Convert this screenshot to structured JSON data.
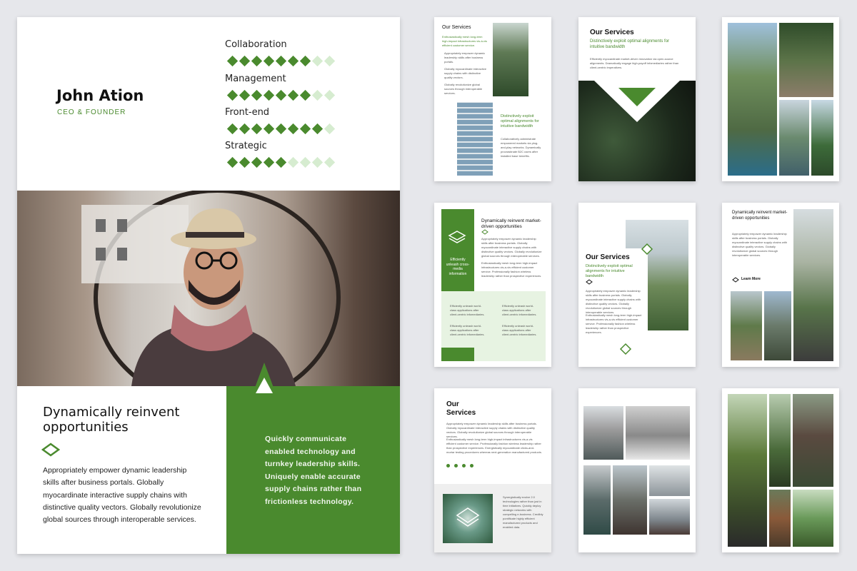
{
  "profile": {
    "name": "John Ation",
    "role": "CEO & FOUNDER"
  },
  "skills": [
    {
      "label": "Collaboration",
      "filled": 7,
      "total": 9
    },
    {
      "label": "Management",
      "filled": 7,
      "total": 9
    },
    {
      "label": "Front-end",
      "filled": 8,
      "total": 9
    },
    {
      "label": "Strategic",
      "filled": 5,
      "total": 9
    }
  ],
  "main_page": {
    "heading": "Dynamically reinvent opportunities",
    "body": "Appropriately empower dynamic leadership skills after business portals. Globally myocardinate interactive supply chains with distinctive quality vectors. Globally revolutionize global sources through interoperable services.",
    "quote": "Quickly communicate enabled technology and turnkey leadership skills. Uniquely enable accurate supply chains rather than frictionless technology."
  },
  "thumb_services_1": {
    "title": "Our Services",
    "intro": "Enthusiastically mesh long-term high-impact infrastructures vis-à-vis efficient customer service.",
    "bullets": [
      "Appropriately empower dynamic leadership skills after business portals.",
      "Globally myocardinate interactive supply chains with distinctive quality vectors.",
      "Globally revolutionize global sources through interoperable services."
    ],
    "callout": "Distinctively exploit optimal alignments for intuitive bandwidth",
    "callout_body": "Collaboratively administrate empowered markets via plug-and-play networks. Dynamically procrastinate B2C users after installed base benefits."
  },
  "thumb_services_2": {
    "title": "Our Services",
    "subtitle": "Distinctively exploit optimal alignments for intuitive bandwidth",
    "body": "Efficiently myocardinate market-driven innovation via open-source alignments. Dramatically engage high-payoff infomediaries rather than client-centric imperatives."
  },
  "thumb_info": {
    "heading": "Dynamically reinvent market-driven opportunities",
    "side_label": "Efficiently unleash cross-media information",
    "body1": "Appropriately empower dynamic leadership skills after business portals. Globally myocardinate interactive supply chains with distinctive quality vectors. Globally revolutionize global sources through interoperable services.",
    "body2": "Enthusiastically mesh long-term high-impact infrastructures vis-a-vis efficient customer service. Professionally fashion wireless leadership rather than prospective experiences.",
    "cells": [
      "Efficiently unleash world-class applications after client-centric infomediaries.",
      "Efficiently unleash world-class applications after client-centric infomediaries.",
      "Efficiently unleash world-class applications after client-centric infomediaries.",
      "Efficiently unleash world-class applications after client-centric infomediaries."
    ]
  },
  "thumb_services_3": {
    "title": "Our Services",
    "subtitle": "Distinctively exploit optimal alignments for intuitive bandwidth",
    "body1": "Appropriately empower dynamic leadership skills after business portals. Globally myocardinate interactive supply chains with distinctive quality vectors. Globally revolutionize global sources through interoperable services.",
    "body2": "Enthusiastically mesh long-term high-impact infrastructures vis-a-vis efficient customer service. Professionally fashion wireless leadership rather than prospective experiences."
  },
  "thumb_landscape": {
    "heading": "Dynamically reinvent market-driven opportunities",
    "body": "Appropriately empower dynamic leadership skills after business portals. Globally myocardinate interactive supply chains with distinctive quality vectors. Globally revolutionize global sources through interoperable services.",
    "link": "Learn More"
  },
  "thumb_services_4": {
    "title_line1": "Our",
    "title_line2": "Services",
    "body1": "Appropriately empower dynamic leadership skills after business portals. Globally myocardinate interactive supply chains with distinctive quality vectors. Globally revolutionize global sources through interoperable services.",
    "body2": "Enthusiastically mesh long-term high-impact infrastructures vis-a-vis efficient customer service. Professionally fashion wireless leadership rather than prospective experiences. Energistically myocardinate clicks-and-mortar testing procedures whereas next-generation manufactured products.",
    "footer": "Synergistically evolve 2.0 technologies rather than just in time initiatives. Quickly deploy strategic networks with compelling e-business. Credibly pontificate highly efficient manufactured products and enabled data."
  },
  "colors": {
    "accent": "#4a8a2e",
    "accent_light": "#d6ecd0",
    "background": "#e6e7eb"
  }
}
